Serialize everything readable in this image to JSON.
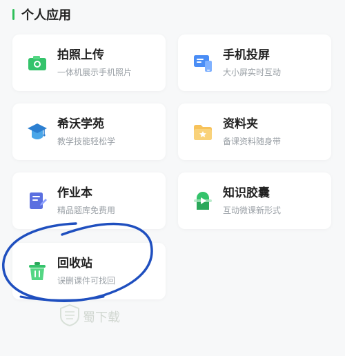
{
  "section": {
    "title": "个人应用"
  },
  "apps": [
    {
      "title": "拍照上传",
      "subtitle": "一体机展示手机照片",
      "icon": "camera-icon"
    },
    {
      "title": "手机投屏",
      "subtitle": "大小屏实时互动",
      "icon": "screen-cast-icon"
    },
    {
      "title": "希沃学苑",
      "subtitle": "教学技能轻松学",
      "icon": "graduation-cap-icon"
    },
    {
      "title": "资料夹",
      "subtitle": "备课资料随身带",
      "icon": "folder-icon"
    },
    {
      "title": "作业本",
      "subtitle": "精品题库免费用",
      "icon": "notebook-icon"
    },
    {
      "title": "知识胶囊",
      "subtitle": "互动微课新形式",
      "icon": "capsule-play-icon"
    },
    {
      "title": "回收站",
      "subtitle": "误删课件可找回",
      "icon": "trash-icon"
    }
  ],
  "watermark": {
    "text": "蜀下载"
  },
  "colors": {
    "accent": "#2fbf5a",
    "annotation": "#1f4fbf"
  }
}
